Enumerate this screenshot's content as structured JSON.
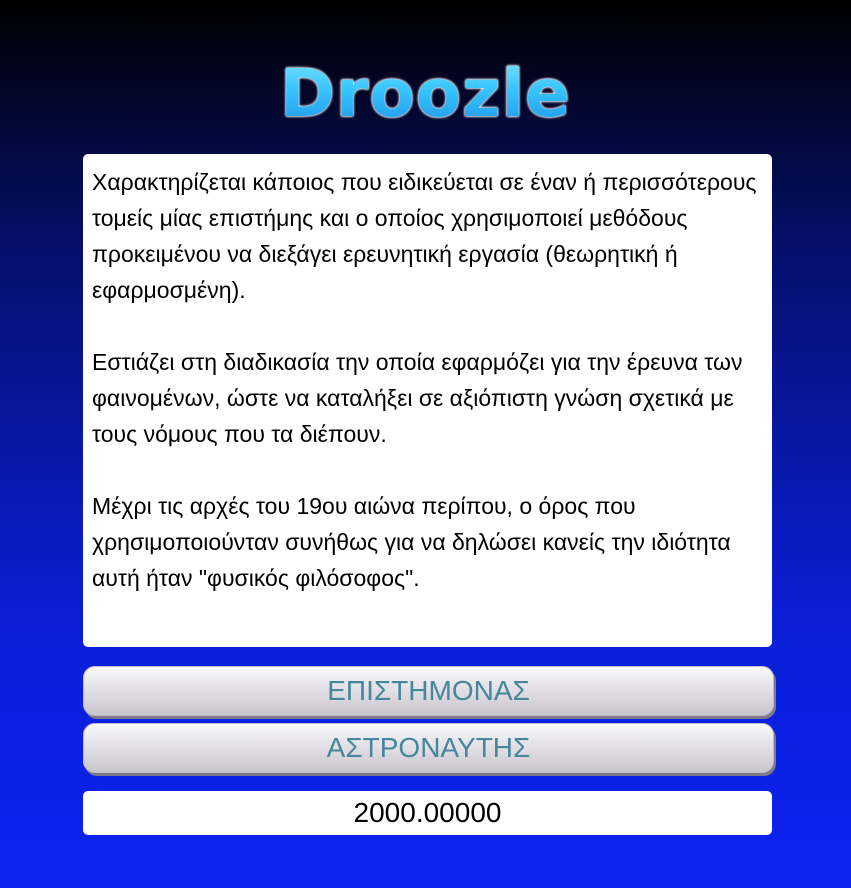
{
  "app": {
    "title": "Droozle"
  },
  "clue": {
    "paragraphs": [
      "Χαρακτηρίζεται κάποιος που ειδικεύεται σε έναν ή περισσότερους τομείς μίας επιστήμης και ο οποίος χρησιμοποιεί μεθόδους προκειμένου να διεξάγει ερευνητική εργασία (θεωρητική ή εφαρμοσμένη).",
      "Εστιάζει στη διαδικασία την οποία εφαρμόζει για την έρευνα των φαινομένων, ώστε να καταλήξει σε αξιόπιστη γνώση σχετικά με τους νόμους που τα διέπουν.",
      "Μέχρι τις αρχές του 19ου αιώνα περίπου, ο όρος που χρησιμοποιούνταν συνήθως για να δηλώσει κανείς την ιδιότητα αυτή ήταν \"φυσικός φιλόσοφος\"."
    ]
  },
  "answers": [
    {
      "label": "ΕΠΙΣΤΗΜΟΝΑΣ"
    },
    {
      "label": "ΑΣΤΡΟΝΑΥΤΗΣ"
    }
  ],
  "score": {
    "value": "2000.00000"
  },
  "colors": {
    "button_text": "#46879a",
    "logo": "#36c4ff",
    "background_bottom": "#0c22f2"
  }
}
